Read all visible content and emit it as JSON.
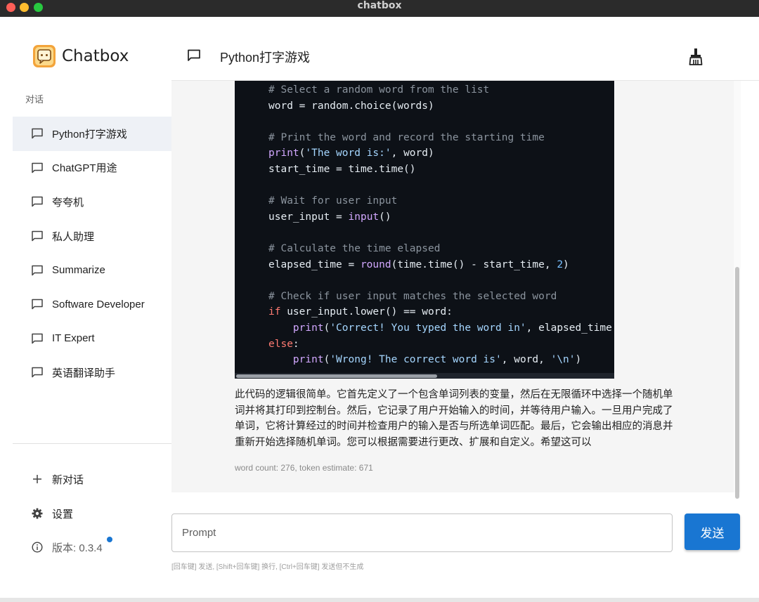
{
  "window": {
    "title": "chatbox"
  },
  "brand": {
    "name": "Chatbox",
    "icon": "chatbox-logo-icon"
  },
  "sidebar": {
    "section_label": "对话",
    "conversations": [
      {
        "label": "Python打字游戏",
        "active": true
      },
      {
        "label": "ChatGPT用途",
        "active": false
      },
      {
        "label": "夸夸机",
        "active": false
      },
      {
        "label": "私人助理",
        "active": false
      },
      {
        "label": "Summarize",
        "active": false
      },
      {
        "label": "Software Developer",
        "active": false
      },
      {
        "label": "IT Expert",
        "active": false
      },
      {
        "label": "英语翻译助手",
        "active": false
      }
    ],
    "new_chat_label": "新对话",
    "settings_label": "设置",
    "version_label": "版本: 0.3.4",
    "update_dot_color": "#1976d2"
  },
  "header": {
    "title": "Python打字游戏",
    "clean_icon": "broom-icon"
  },
  "message": {
    "code_lines": [
      [
        {
          "t": "# Select a random word from the list",
          "c": "com"
        }
      ],
      [
        {
          "t": "word = random.choice(words)"
        }
      ],
      [],
      [
        {
          "t": "# Print the word and record the starting time",
          "c": "com"
        }
      ],
      [
        {
          "t": "print",
          "c": "fn"
        },
        {
          "t": "("
        },
        {
          "t": "'The word is:'",
          "c": "str"
        },
        {
          "t": ", word)"
        }
      ],
      [
        {
          "t": "start_time = time.time()"
        }
      ],
      [],
      [
        {
          "t": "# Wait for user input",
          "c": "com"
        }
      ],
      [
        {
          "t": "user_input = "
        },
        {
          "t": "input",
          "c": "fn"
        },
        {
          "t": "()"
        }
      ],
      [],
      [
        {
          "t": "# Calculate the time elapsed",
          "c": "com"
        }
      ],
      [
        {
          "t": "elapsed_time = "
        },
        {
          "t": "round",
          "c": "fn"
        },
        {
          "t": "(time.time() - start_time, "
        },
        {
          "t": "2",
          "c": "num"
        },
        {
          "t": ")"
        }
      ],
      [],
      [
        {
          "t": "# Check if user input matches the selected word",
          "c": "com"
        }
      ],
      [
        {
          "t": "if",
          "c": "kw"
        },
        {
          "t": " user_input.lower() == word:"
        }
      ],
      [
        {
          "t": "    "
        },
        {
          "t": "print",
          "c": "fn"
        },
        {
          "t": "("
        },
        {
          "t": "'Correct! You typed the word in'",
          "c": "str"
        },
        {
          "t": ", elapsed_time"
        }
      ],
      [
        {
          "t": "else",
          "c": "kw"
        },
        {
          "t": ":"
        }
      ],
      [
        {
          "t": "    "
        },
        {
          "t": "print",
          "c": "fn"
        },
        {
          "t": "("
        },
        {
          "t": "'Wrong! The correct word is'",
          "c": "str"
        },
        {
          "t": ", word, "
        },
        {
          "t": "'\\n'",
          "c": "str"
        },
        {
          "t": ")"
        }
      ]
    ],
    "explanation": "此代码的逻辑很简单。它首先定义了一个包含单词列表的变量，然后在无限循环中选择一个随机单词并将其打印到控制台。然后，它记录了用户开始输入的时间，并等待用户输入。一旦用户完成了单词，它将计算经过的时间并检查用户的输入是否与所选单词匹配。最后，它会输出相应的消息并重新开始选择随机单词。您可以根据需要进行更改、扩展和自定义。希望这可以",
    "word_count": "word count: 276, token estimate: 671"
  },
  "input": {
    "placeholder": "Prompt",
    "value": "",
    "send_label": "发送",
    "hint": "[回车键] 发送, [Shift+回车键] 换行, [Ctrl+回车键] 发送但不生成"
  },
  "colors": {
    "accent": "#1976d2",
    "code_bg": "#0d1117",
    "active_item_bg": "#eef1f6",
    "message_bg": "#f5f5f5"
  }
}
